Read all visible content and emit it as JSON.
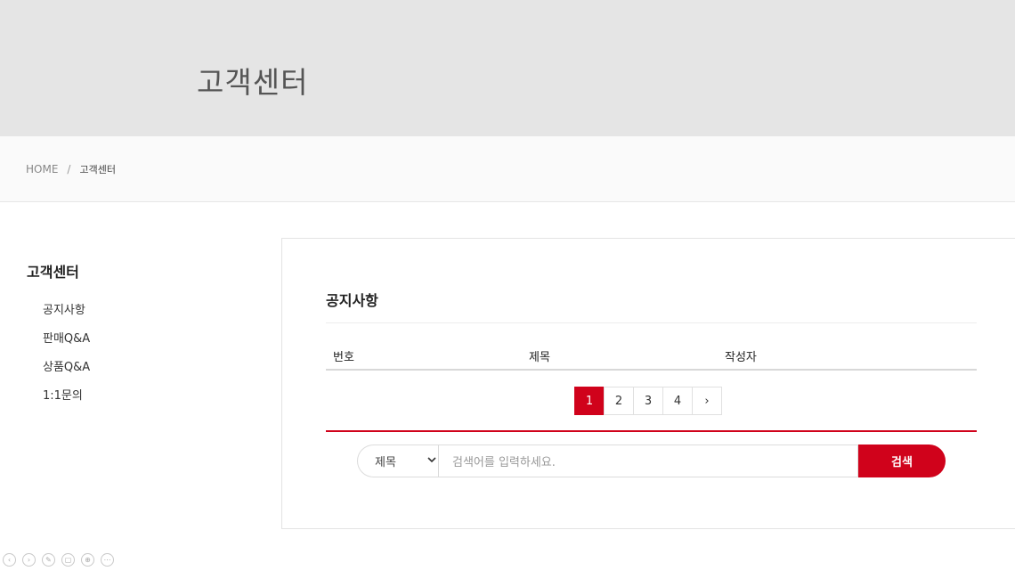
{
  "hero": {
    "title": "고객센터"
  },
  "breadcrumb": {
    "home": "HOME",
    "separator": "/",
    "current": "고객센터"
  },
  "sidebar": {
    "title": "고객센터",
    "items": [
      {
        "label": "공지사항"
      },
      {
        "label": "판매Q&A"
      },
      {
        "label": "상품Q&A"
      },
      {
        "label": "1:1문의"
      }
    ]
  },
  "board": {
    "title": "공지사항",
    "columns": [
      "번호",
      "제목",
      "작성자"
    ]
  },
  "pagination": {
    "pages": [
      "1",
      "2",
      "3",
      "4"
    ],
    "current": "1",
    "next": "›"
  },
  "search": {
    "field_selected": "제목",
    "placeholder": "검색어를 입력하세요.",
    "button_label": "검색"
  },
  "colors": {
    "accent": "#d0021b",
    "hero_bg": "#e5e5e5"
  },
  "bottom_toolbar": {
    "icons": [
      "prev-icon",
      "play-icon",
      "pen-icon",
      "copy-icon",
      "zoom-icon",
      "more-icon"
    ]
  }
}
